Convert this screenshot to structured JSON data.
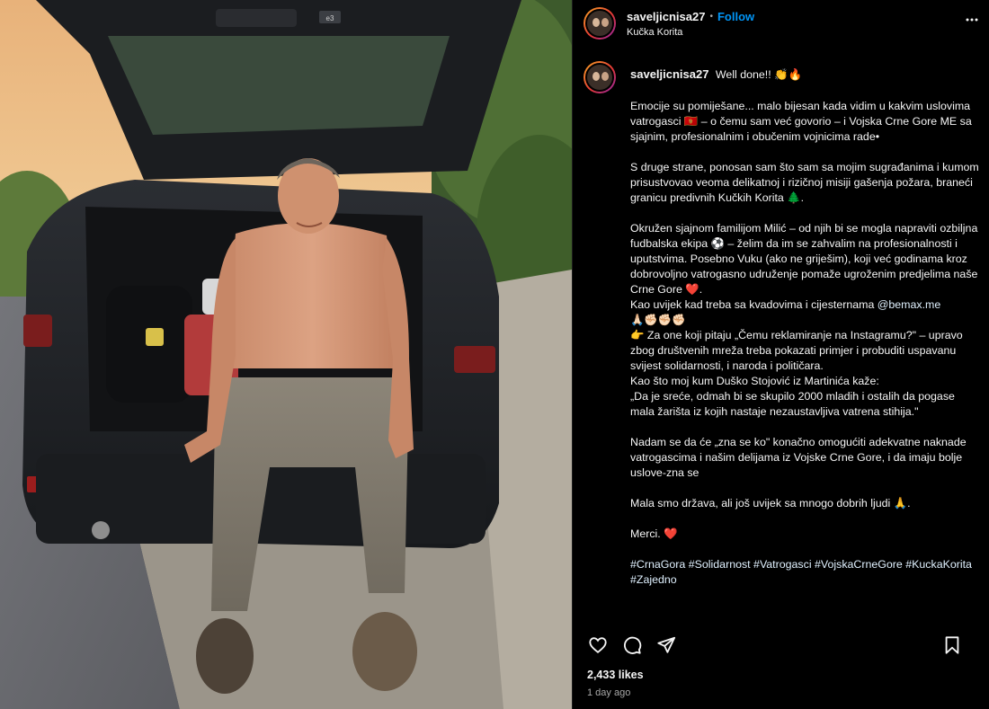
{
  "header": {
    "username": "saveljicnisa27",
    "separator": "•",
    "follow_label": "Follow",
    "location": "Kučka Korita",
    "more_icon": "more-horizontal-icon"
  },
  "caption": {
    "username": "saveljicnisa27",
    "first_line": "Well done!! 👏🔥",
    "p1": "Emocije su pomiješane... malo bijesan kada vidim u kakvim uslovima vatrogasci 🇲🇪 – o čemu sam već govorio – i Vojska Crne Gore ME sa sjajnim, profesionalnim i obučenim vojnicima rade•",
    "p2": "S druge strane, ponosan sam što sam sa mojim sugrađanima i kumom prisustvovao veoma delikatnoj i rizičnoj misiji gašenja požara, braneći granicu predivnih Kučkih Korita 🌲.",
    "p3a": "Okružen sjajnom familijom Milić – od njih bi se mogla napraviti ozbiljna fudbalska ekipa ⚽ – želim da im se zahvalim na profesionalnosti i uputstvima. Posebno Vuku (ako ne griješim), koji već godinama kroz dobrovoljno vatrogasno udruženje pomaže ugroženim predjelima naše Crne Gore ❤️.",
    "p3b_text": "Kao uvijek kad treba sa kvadovima i cijesternama ",
    "p3b_mention": "@bemax.me",
    "p3c": "🙏🏻✊🏻✊🏻✊🏻",
    "p3d": "👉 Za one koji pitaju „Čemu reklamiranje na Instagramu?\" – upravo zbog društvenih mreža treba pokazati primjer i probuditi uspavanu svijest solidarnosti, i naroda i političara.",
    "p3e": "Kao što moj kum Duško Stojović iz Martinića kaže:",
    "p3f": "„Da je sreće, odmah bi se skupilo 2000 mladih i ostalih da pogase mala žarišta iz kojih nastaje nezaustavljiva vatrena stihija.\"",
    "p4": "Nadam se da će „zna se ko\" konačno omogućiti adekvatne naknade vatrogascima i našim delijama iz Vojske Crne Gore, i da imaju bolje uslove-zna se",
    "p5": "Mala smo država, ali još uvijek sa mnogo dobrih ljudi 🙏.",
    "p6": "Merci. ❤️",
    "hashtags": "#CrnaGora #Solidarnost #Vatrogasci #VojskaCrneGore #KuckaKorita #Zajedno"
  },
  "actions": {
    "like_icon": "heart-icon",
    "comment_icon": "comment-icon",
    "share_icon": "send-icon",
    "save_icon": "bookmark-icon"
  },
  "likes": "2,433 likes",
  "time": "1 day ago",
  "photo": {
    "plate_text": "e3"
  },
  "colors": {
    "follow": "#0095f6",
    "background": "#000000",
    "muted": "#a8a8a8"
  }
}
